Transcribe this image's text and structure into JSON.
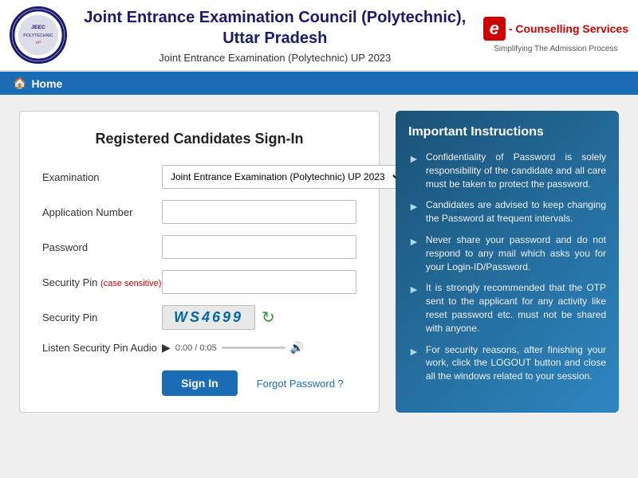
{
  "header": {
    "main_title": "Joint Entrance Examination Council (Polytechnic),",
    "main_title2": "Uttar Pradesh",
    "sub_title": "Joint Entrance Examination (Polytechnic) UP 2023",
    "ecounselling_e": "e",
    "ecounselling_label": "- Counselling Services",
    "ecounselling_sub": "Simplifying The Admission Process"
  },
  "navbar": {
    "home_label": "Home"
  },
  "signin_form": {
    "title": "Registered Candidates Sign-In",
    "examination_label": "Examination",
    "examination_value": "Joint Entrance Examination (Polytechnic) UP 2023",
    "application_number_label": "Application Number",
    "password_label": "Password",
    "security_pin_label": "Security Pin",
    "security_pin_case": "(case sensitive)",
    "security_pin_image_label": "Security Pin",
    "captcha_value": "WS4699",
    "listen_pin_label": "Listen Security Pin Audio",
    "audio_time": "0:00 / 0:05",
    "btn_signin": "Sign In",
    "btn_forgot": "Forgot Password ?"
  },
  "instructions": {
    "title": "Important Instructions",
    "items": [
      "Confidentiality of Password is solely responsibility of the candidate and all care must be taken to protect the password.",
      "Candidates are advised to keep changing the Password at frequent intervals.",
      "Never share your password and do not respond to any mail which asks you for your Login-ID/Password.",
      "It is strongly recommended that the OTP sent to the applicant for any activity like reset password etc. must not be shared with anyone.",
      "For security reasons, after finishing your work, click the LOGOUT button and close all the windows related to your session."
    ]
  }
}
